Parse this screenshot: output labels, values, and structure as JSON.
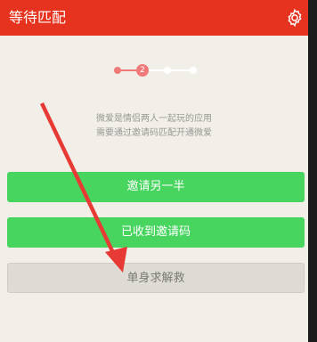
{
  "header": {
    "title": "等待匹配",
    "settings_icon": "gear-icon",
    "background_color": "#e5331f"
  },
  "stepper": {
    "current_step": "2",
    "total_steps": 4,
    "active_color": "#f07a7a"
  },
  "description": {
    "line1": "微爱是情侣两人一起玩的应用",
    "line2": "需要通过邀请码匹配开通微爱"
  },
  "buttons": {
    "invite_partner": "邀请另一半",
    "received_code": "已收到邀请码",
    "single_help": "单身求解救"
  },
  "annotation": {
    "arrow_color": "#e83a35"
  },
  "colors": {
    "green_button": "#47d45f",
    "gray_button": "#dedad4",
    "page_background": "#f2efe9"
  }
}
